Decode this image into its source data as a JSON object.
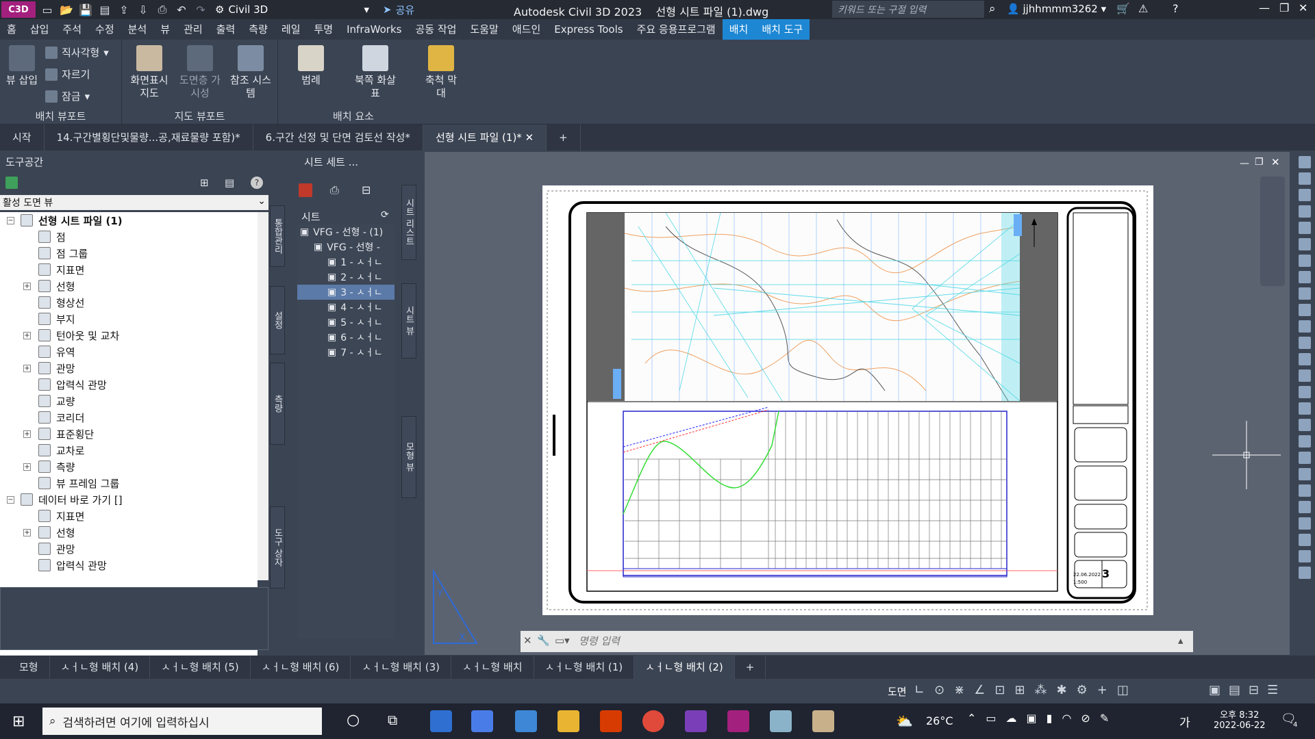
{
  "titlebar": {
    "logo": "C3D",
    "workspace": "Civil 3D",
    "share": "공유",
    "app_title": "Autodesk Civil 3D 2023",
    "file_title": "선형 시트 파일 (1).dwg",
    "search_placeholder": "키워드 또는 구절 입력",
    "user": "jjhhmmm3262"
  },
  "menu": [
    "홈",
    "삽입",
    "주석",
    "수정",
    "분석",
    "뷰",
    "관리",
    "출력",
    "측량",
    "레일",
    "투명",
    "InfraWorks",
    "공동 작업",
    "도움말",
    "애드인",
    "Express Tools",
    "주요 응용프로그램",
    "배치",
    "배치 도구"
  ],
  "ribbon": {
    "groups": {
      "layout_viewport": "배치 뷰포트",
      "map_viewport": "지도 뷰포트",
      "layout_elements": "배치 요소"
    },
    "buttons": {
      "insert_view": "뷰 삽입",
      "rectangular": "직사각형",
      "clip": "자르기",
      "lock": "잠금",
      "display_map": "화면표시 지도",
      "layer_visibility": "도면층 가시성",
      "reference_system": "참조 시스템",
      "legend": "범례",
      "north_arrow": "북쪽 화살표",
      "scale_bar": "축척 막대"
    }
  },
  "doc_tabs": [
    "시작",
    "14.구간별횡단및물량...공,재료물량 포함)*",
    "6.구간 선정 및 단면 검토선 작성*",
    "선형 시트 파일 (1)*"
  ],
  "toolspace": {
    "title": "도구공간",
    "view_select": "활성 도면 뷰",
    "tree": [
      {
        "label": "선형 시트 파일 (1)",
        "level": 0,
        "bold": true,
        "exp": "-"
      },
      {
        "label": "점",
        "level": 2
      },
      {
        "label": "점 그룹",
        "level": 2
      },
      {
        "label": "지표면",
        "level": 2
      },
      {
        "label": "선형",
        "level": 2,
        "exp": "+"
      },
      {
        "label": "형상선",
        "level": 2
      },
      {
        "label": "부지",
        "level": 2
      },
      {
        "label": "턴아웃 및 교차",
        "level": 2,
        "exp": "+"
      },
      {
        "label": "유역",
        "level": 2
      },
      {
        "label": "관망",
        "level": 2,
        "exp": "+"
      },
      {
        "label": "압력식 관망",
        "level": 2
      },
      {
        "label": "교량",
        "level": 2
      },
      {
        "label": "코리더",
        "level": 2
      },
      {
        "label": "표준횡단",
        "level": 2,
        "exp": "+"
      },
      {
        "label": "교차로",
        "level": 2
      },
      {
        "label": "측량",
        "level": 2,
        "exp": "+"
      },
      {
        "label": "뷰 프레임 그룹",
        "level": 2
      },
      {
        "label": "데이터 바로 가기 []",
        "level": 0,
        "exp": "-"
      },
      {
        "label": "지표면",
        "level": 2
      },
      {
        "label": "선형",
        "level": 2,
        "exp": "+"
      },
      {
        "label": "관망",
        "level": 2
      },
      {
        "label": "압력식 관망",
        "level": 2
      }
    ],
    "side_tabs": [
      "통합관리",
      "설정",
      "측량",
      "도구 상자"
    ]
  },
  "sheetset": {
    "title": "시트 세트 ...",
    "list_header": "시트",
    "rows": [
      {
        "label": "VFG - 선형 - (1)",
        "indent": 0
      },
      {
        "label": "VFG - 선형 -",
        "indent": 1
      },
      {
        "label": "1 - ㅅㅓㄴ",
        "indent": 2
      },
      {
        "label": "2 - ㅅㅓㄴ",
        "indent": 2
      },
      {
        "label": "3 - ㅅㅓㄴ",
        "indent": 2,
        "selected": true
      },
      {
        "label": "4 - ㅅㅓㄴ",
        "indent": 2
      },
      {
        "label": "5 - ㅅㅓㄴ",
        "indent": 2
      },
      {
        "label": "6 - ㅅㅓㄴ",
        "indent": 2
      },
      {
        "label": "7 - ㅅㅓㄴ",
        "indent": 2
      }
    ],
    "side_tabs": [
      "시트 리스트",
      "시트 뷰",
      "모형 뷰"
    ]
  },
  "drawing": {
    "sheet_number": "3",
    "scale": "1:500",
    "date": "22.06.2022",
    "command_placeholder": "명령 입력"
  },
  "layout_tabs": [
    "모형",
    "ㅅㅓㄴ형 배치 (4)",
    "ㅅㅓㄴ형 배치 (5)",
    "ㅅㅓㄴ형 배치 (6)",
    "ㅅㅓㄴ형 배치 (3)",
    "ㅅㅓㄴ형 배치",
    "ㅅㅓㄴ형 배치 (1)",
    "ㅅㅓㄴ형 배치 (2)"
  ],
  "statusbar": {
    "mode": "도면"
  },
  "taskbar": {
    "search": "검색하려면 여기에 입력하십시",
    "weather": "26°C",
    "ime": "가",
    "time": "오후 8:32",
    "date": "2022-06-22",
    "notifications": "4"
  }
}
